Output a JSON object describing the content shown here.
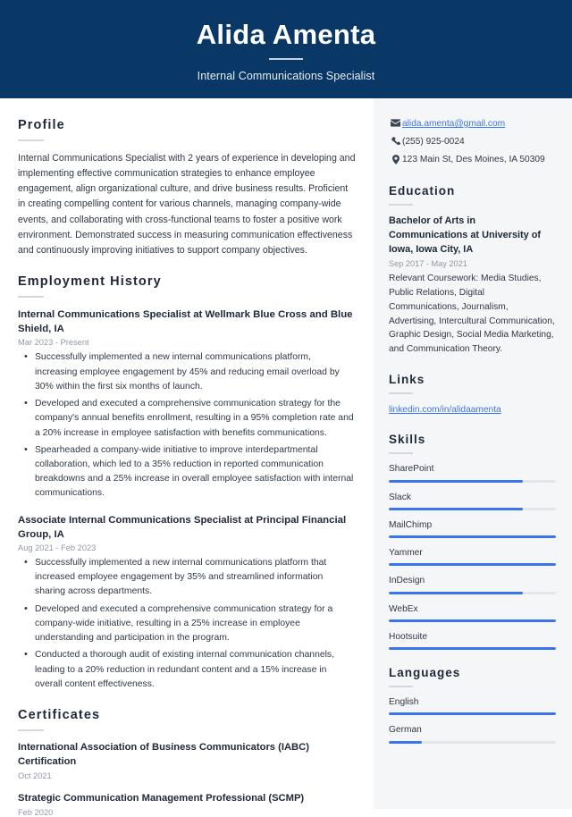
{
  "header": {
    "name": "Alida Amenta",
    "job_title": "Internal Communications Specialist"
  },
  "colors": {
    "header_background": "#0a3866",
    "accent": "#3b76e8",
    "sidebar_background": "#f5f6f7",
    "heading_text": "#20293a",
    "muted_text": "#9199a4"
  },
  "main": {
    "profile": {
      "heading": "Profile",
      "text": "Internal Communications Specialist with 2 years of experience in developing and implementing effective communication strategies to enhance employee engagement, align organizational culture, and drive business results. Proficient in creating compelling content for various channels, managing company-wide events, and collaborating with cross-functional teams to foster a positive work environment. Demonstrated success in measuring communication effectiveness and continuously improving initiatives to support company objectives."
    },
    "employment": {
      "heading": "Employment History",
      "jobs": [
        {
          "title": "Internal Communications Specialist at Wellmark Blue Cross and Blue Shield, IA",
          "date": "Mar 2023 - Present",
          "bullets": [
            "Successfully implemented a new internal communications platform, increasing employee engagement by 45% and reducing email overload by 30% within the first six months of launch.",
            "Developed and executed a comprehensive communication strategy for the company's annual benefits enrollment, resulting in a 95% completion rate and a 20% increase in employee satisfaction with benefits communications.",
            "Spearheaded a company-wide initiative to improve interdepartmental collaboration, which led to a 35% reduction in reported communication breakdowns and a 25% increase in overall employee satisfaction with internal communications."
          ]
        },
        {
          "title": "Associate Internal Communications Specialist at Principal Financial Group, IA",
          "date": "Aug 2021 - Feb 2023",
          "bullets": [
            "Successfully implemented a new internal communications platform that increased employee engagement by 35% and streamlined information sharing across departments.",
            "Developed and executed a comprehensive communication strategy for a company-wide initiative, resulting in a 25% increase in employee understanding and participation in the program.",
            "Conducted a thorough audit of existing internal communication channels, leading to a 20% reduction in redundant content and a 15% increase in overall content effectiveness."
          ]
        }
      ]
    },
    "certificates": {
      "heading": "Certificates",
      "items": [
        {
          "title": "International Association of Business Communicators (IABC) Certification",
          "date": "Oct 2021"
        },
        {
          "title": "Strategic Communication Management Professional (SCMP)",
          "date": "Feb 2020"
        }
      ]
    }
  },
  "sidebar": {
    "contact": [
      {
        "icon": "envelope-icon",
        "value": "alida.amenta@gmail.com",
        "is_link": true
      },
      {
        "icon": "phone-icon",
        "value": "(255) 925-0024",
        "is_link": false
      },
      {
        "icon": "location-pin-icon",
        "value": "123 Main St, Des Moines, IA 50309",
        "is_link": false
      }
    ],
    "education": {
      "heading": "Education",
      "degree": "Bachelor of Arts in Communications at University of Iowa, Iowa City, IA",
      "date": "Sep 2017 - May 2021",
      "description": "Relevant Coursework: Media Studies, Public Relations, Digital Communications, Journalism, Advertising, Intercultural Communication, Graphic Design, Social Media Marketing, and Communication Theory."
    },
    "links": {
      "heading": "Links",
      "items": [
        {
          "label": "linkedin.com/in/alidaamenta"
        }
      ]
    },
    "skills": {
      "heading": "Skills",
      "items": [
        {
          "label": "SharePoint",
          "level": 80
        },
        {
          "label": "Slack",
          "level": 80
        },
        {
          "label": "MailChimp",
          "level": 100
        },
        {
          "label": "Yammer",
          "level": 100
        },
        {
          "label": "InDesign",
          "level": 80
        },
        {
          "label": "WebEx",
          "level": 100
        },
        {
          "label": "Hootsuite",
          "level": 100
        }
      ]
    },
    "languages": {
      "heading": "Languages",
      "items": [
        {
          "label": "English",
          "level": 100
        },
        {
          "label": "German",
          "level": 20
        }
      ]
    }
  }
}
